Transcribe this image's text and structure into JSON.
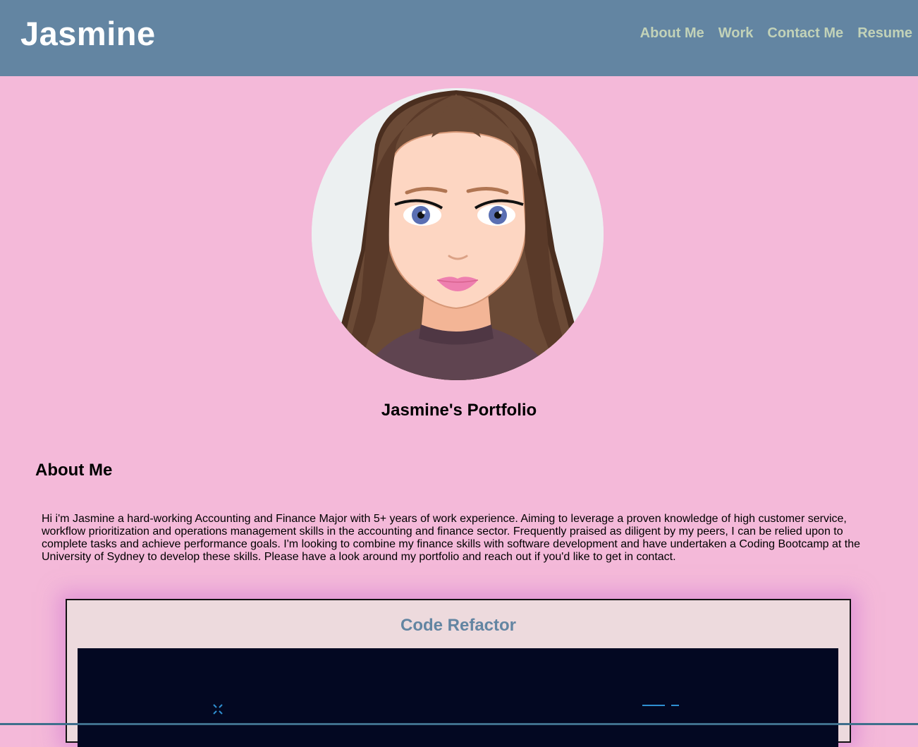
{
  "header": {
    "brand": "Jasmine",
    "nav": [
      "About Me",
      "Work",
      "Contact Me",
      "Resume"
    ]
  },
  "hero": {
    "title": "Jasmine's Portfolio"
  },
  "about": {
    "heading": "About Me",
    "text": "Hi i'm Jasmine a hard-working Accounting and Finance Major with 5+ years of work experience. Aiming to leverage a proven knowledge of high customer service, workflow prioritization and operations management skills in the accounting and finance sector. Frequently praised as diligent by my peers, I can be relied upon to complete tasks and achieve performance goals. I'm looking to combine my finance skills with software development and have undertaken a Coding Bootcamp at the University of Sydney to develop these skills. Please have a look around my portfolio and reach out if you'd like to get in contact."
  },
  "work": {
    "projects": [
      {
        "title": "Code Refactor"
      }
    ]
  },
  "colors": {
    "page_background": "#f4b9d9",
    "header_background": "#6385a2",
    "nav_link": "#c2d2b8",
    "card_background": "#eddadd",
    "card_title": "#6385a2"
  }
}
